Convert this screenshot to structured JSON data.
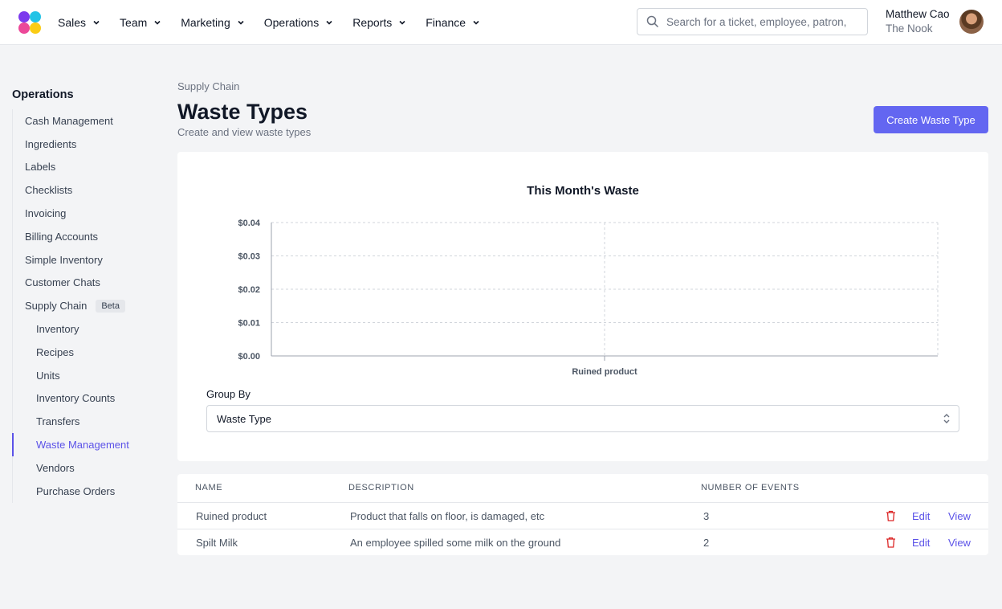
{
  "nav": {
    "items": [
      {
        "label": "Sales"
      },
      {
        "label": "Team"
      },
      {
        "label": "Marketing"
      },
      {
        "label": "Operations"
      },
      {
        "label": "Reports"
      },
      {
        "label": "Finance"
      }
    ],
    "search_placeholder": "Search for a ticket, employee, patron, p",
    "user_name": "Matthew Cao",
    "user_org": "The Nook"
  },
  "sidebar": {
    "title": "Operations",
    "items": [
      {
        "label": "Cash Management"
      },
      {
        "label": "Ingredients"
      },
      {
        "label": "Labels"
      },
      {
        "label": "Checklists"
      },
      {
        "label": "Invoicing"
      },
      {
        "label": "Billing Accounts"
      },
      {
        "label": "Simple Inventory"
      },
      {
        "label": "Customer Chats"
      },
      {
        "label": "Supply Chain",
        "badge": "Beta"
      }
    ],
    "sub_items": [
      {
        "label": "Inventory"
      },
      {
        "label": "Recipes"
      },
      {
        "label": "Units"
      },
      {
        "label": "Inventory Counts"
      },
      {
        "label": "Transfers"
      },
      {
        "label": "Waste Management",
        "active": true
      },
      {
        "label": "Vendors"
      },
      {
        "label": "Purchase Orders"
      }
    ]
  },
  "header": {
    "breadcrumb": "Supply Chain",
    "title": "Waste Types",
    "subtitle": "Create and view waste types",
    "create_button": "Create Waste Type"
  },
  "chart_data": {
    "type": "bar",
    "title": "This Month's Waste",
    "categories": [
      "Ruined product"
    ],
    "values": [
      0
    ],
    "yticks": [
      "$0.00",
      "$0.01",
      "$0.02",
      "$0.03",
      "$0.04"
    ],
    "ylim": [
      0,
      0.04
    ],
    "grid": true,
    "xlabel": "",
    "ylabel": ""
  },
  "group_by": {
    "label": "Group By",
    "value": "Waste Type"
  },
  "table": {
    "headers": [
      "NAME",
      "DESCRIPTION",
      "NUMBER OF EVENTS"
    ],
    "rows": [
      {
        "name": "Ruined product",
        "description": "Product that falls on floor, is damaged, etc",
        "events": "3",
        "edit": "Edit",
        "view": "View"
      },
      {
        "name": "Spilt Milk",
        "description": "An employee spilled some milk on the ground",
        "events": "2",
        "edit": "Edit",
        "view": "View"
      }
    ]
  },
  "colors": {
    "accent": "#6366f1",
    "link": "#5b52e8",
    "danger": "#dc2626"
  }
}
